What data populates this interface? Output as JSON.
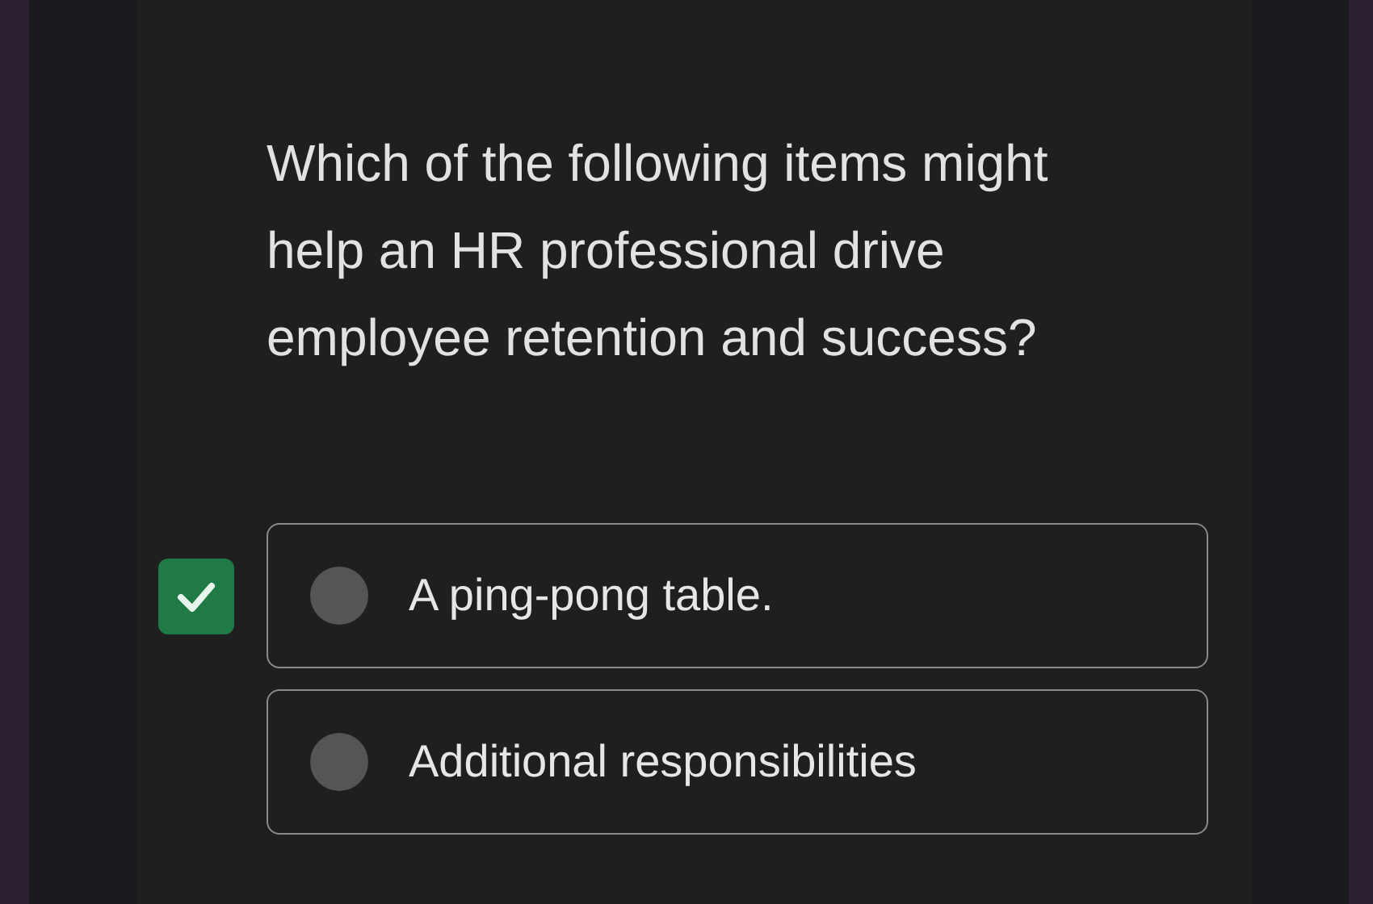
{
  "question": "Which of the following items might help an HR professional drive employee retention and success?",
  "options": [
    {
      "label": "A ping-pong table.",
      "checked": true,
      "selected": false
    },
    {
      "label": "Additional responsibilities",
      "checked": false,
      "selected": false
    }
  ]
}
